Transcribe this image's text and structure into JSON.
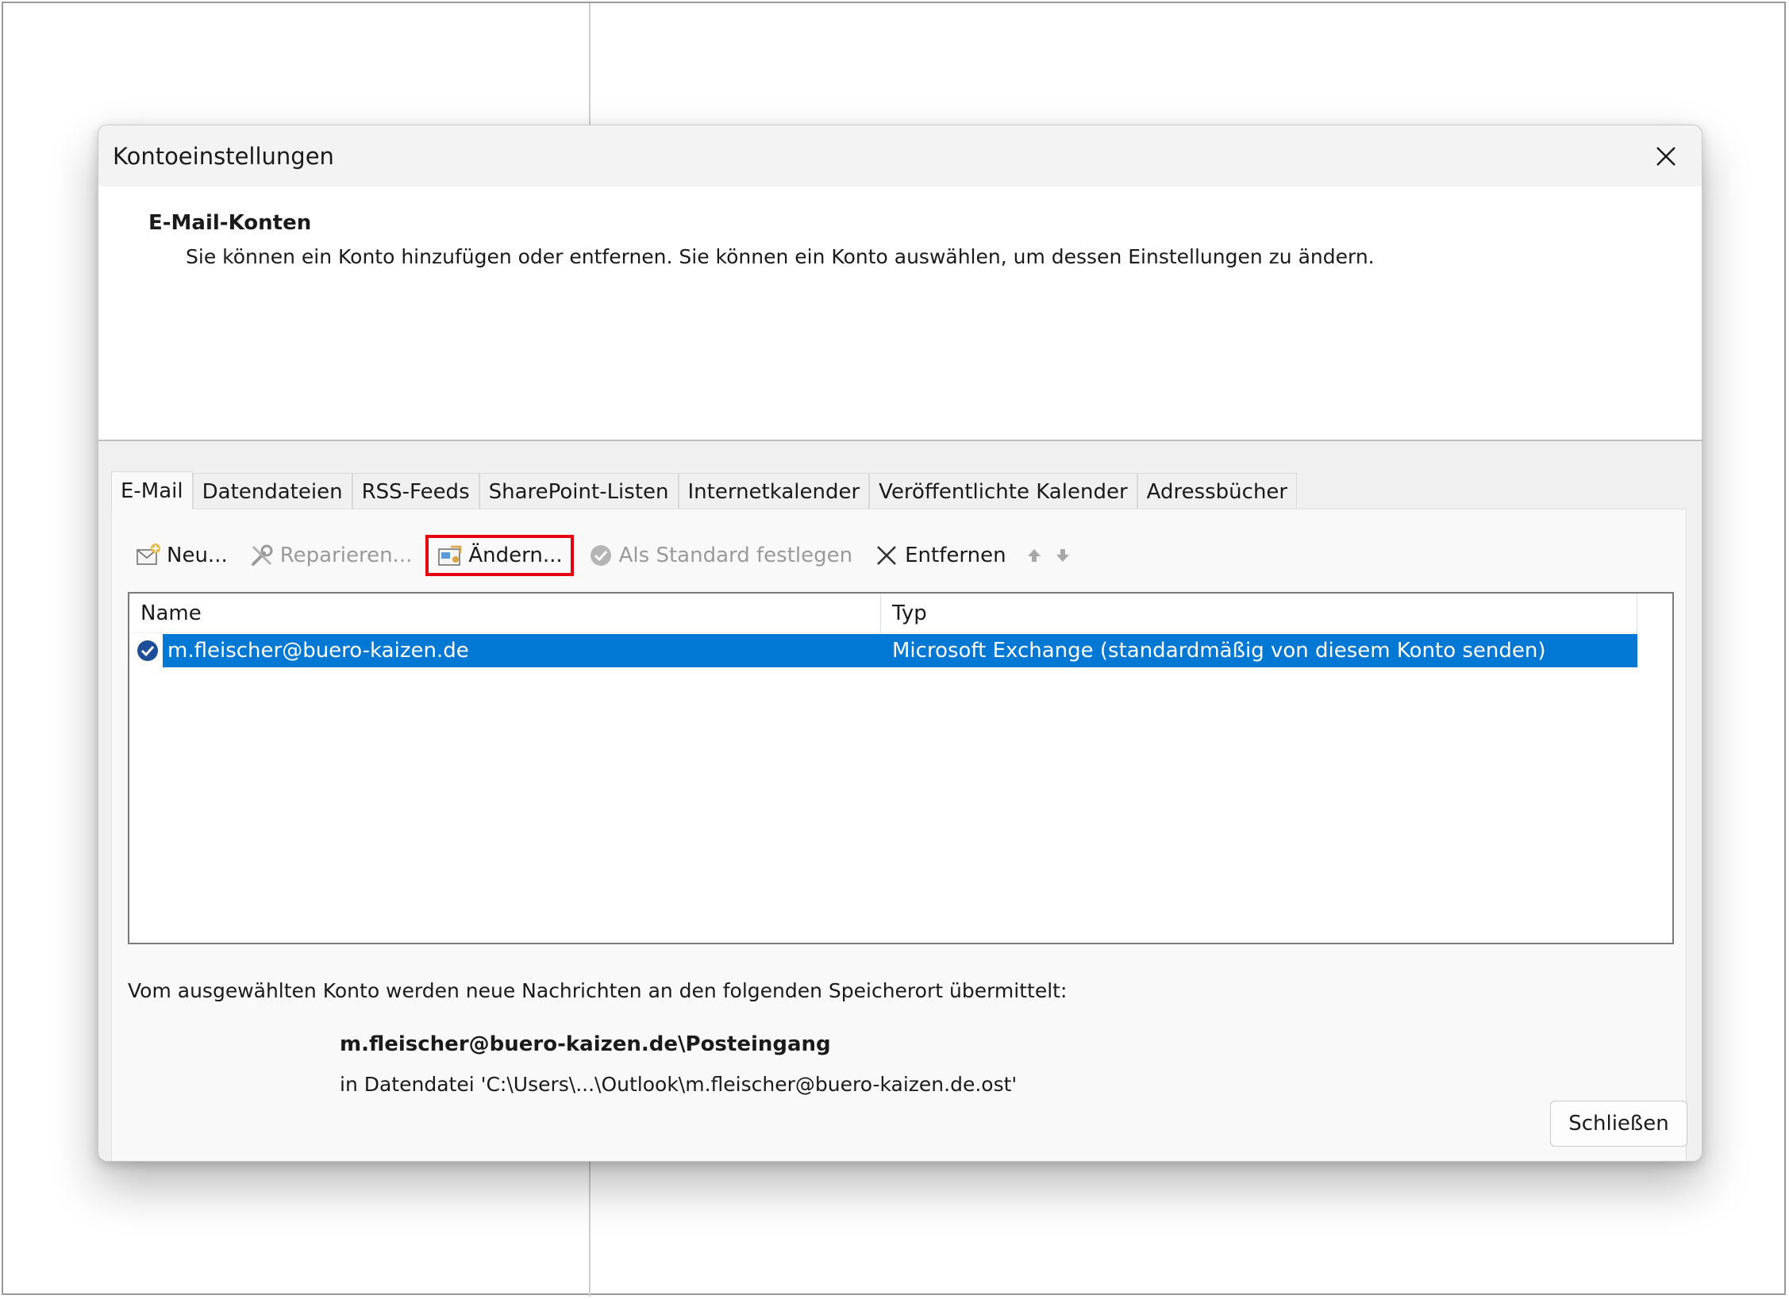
{
  "dialog": {
    "title": "Kontoeinstellungen",
    "close_icon": "close-icon"
  },
  "header": {
    "title": "E-Mail-Konten",
    "description": "Sie können ein Konto hinzufügen oder entfernen. Sie können ein Konto auswählen, um dessen Einstellungen zu ändern."
  },
  "tabs": [
    {
      "label": "E-Mail",
      "active": true
    },
    {
      "label": "Datendateien",
      "active": false
    },
    {
      "label": "RSS-Feeds",
      "active": false
    },
    {
      "label": "SharePoint-Listen",
      "active": false
    },
    {
      "label": "Internetkalender",
      "active": false
    },
    {
      "label": "Veröffentlichte Kalender",
      "active": false
    },
    {
      "label": "Adressbücher",
      "active": false
    }
  ],
  "toolbar": {
    "new_label": "Neu...",
    "repair_label": "Reparieren...",
    "change_label": "Ändern...",
    "set_default_label": "Als Standard festlegen",
    "remove_label": "Entfernen",
    "move_up_icon": "arrow-up-icon",
    "move_down_icon": "arrow-down-icon"
  },
  "accounts_table": {
    "columns": [
      "Name",
      "Typ"
    ],
    "rows": [
      {
        "name": "m.fleischer@buero-kaizen.de",
        "type": "Microsoft Exchange (standardmäßig von diesem Konto senden)",
        "selected": true,
        "default": true
      }
    ]
  },
  "delivery": {
    "label": "Vom ausgewählten Konto werden neue Nachrichten an den folgenden Speicherort übermittelt:",
    "folder": "m.fleischer@buero-kaizen.de\\Posteingang",
    "file": "in Datendatei 'C:\\Users\\...\\Outlook\\m.fleischer@buero-kaizen.de.ost'"
  },
  "footer": {
    "close_label": "Schließen"
  },
  "colors": {
    "selection": "#0078d4",
    "highlight_border": "#e3000f"
  }
}
